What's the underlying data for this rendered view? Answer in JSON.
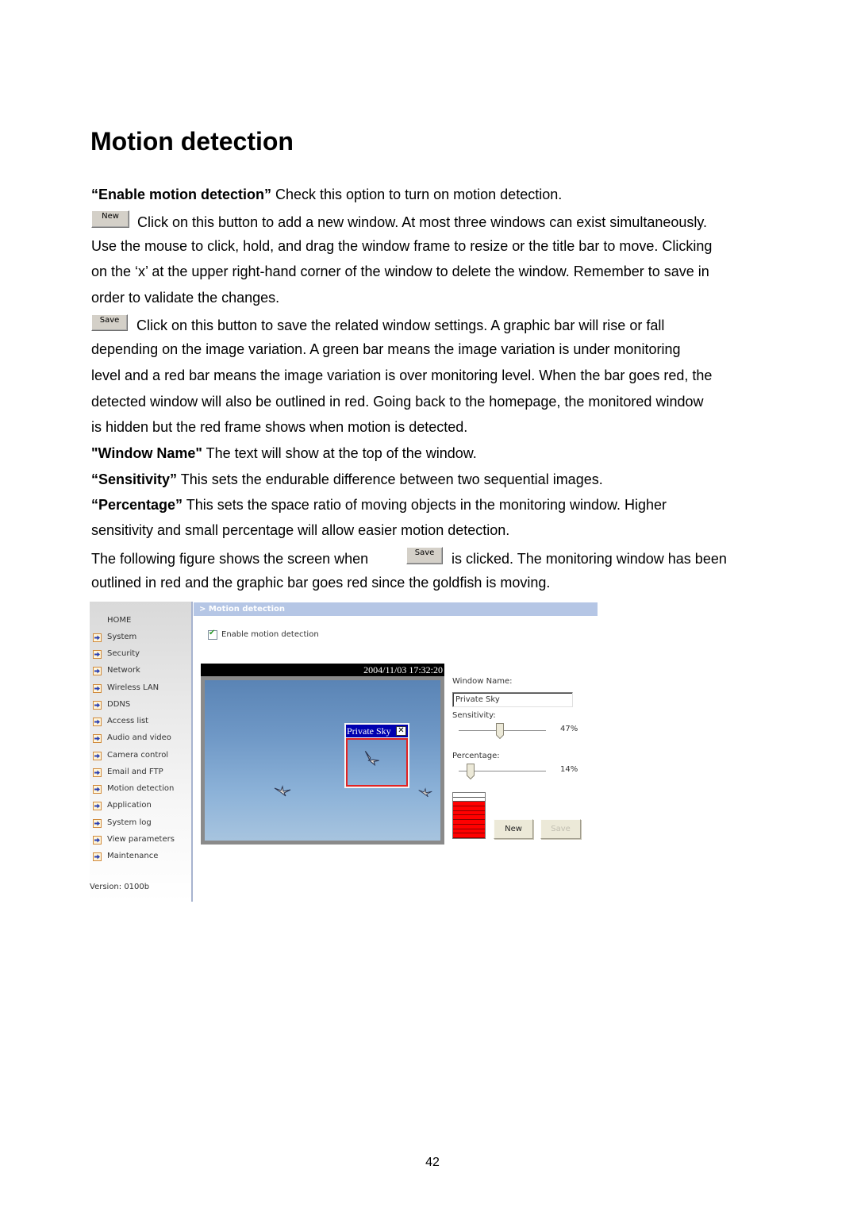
{
  "doc": {
    "title": "Motion detection",
    "p1": {
      "term": "“Enable motion detection”",
      "text": " Check this option to turn on motion detection."
    },
    "p2": {
      "button_label": "New",
      "lines": [
        "Click on this button to add a new window. At most three windows can exist simultaneously.",
        "Use the mouse to click, hold, and drag the window frame to resize or the title bar to move. Clicking",
        "on the ‘x’ at the upper right-hand corner of the window to delete the window. Remember to save in",
        "order to validate the changes."
      ]
    },
    "p3": {
      "button_label": "Save",
      "lines": [
        "Click on this button to save the related window settings. A graphic bar will rise or fall",
        "depending on the image variation. A green bar means the image variation is under monitoring",
        "level and a red bar means the image variation is over monitoring level. When the bar goes red, the",
        "detected window will also be outlined in red. Going back to the homepage, the monitored window",
        "is hidden but the red frame shows when motion is detected."
      ]
    },
    "p4": {
      "term": "\"Window Name\"",
      "text": " The text will show at the top of the window."
    },
    "p5": {
      "term": "“Sensitivity”",
      "text": " This sets the endurable difference between two sequential images."
    },
    "p6": {
      "term": "“Percentage”",
      "lines": [
        " This sets the space ratio of moving objects in the monitoring window. Higher",
        "sensitivity and small percentage will allow easier motion detection."
      ]
    },
    "p7": {
      "before": "The following figure shows the screen when",
      "button_label": "Save",
      "after": "is clicked. The monitoring window has been",
      "line2": "outlined in red and the graphic bar goes red since the goldfish is moving."
    },
    "page_number": "42"
  },
  "screenshot": {
    "sidebar": {
      "home": "HOME",
      "items": [
        "System",
        "Security",
        "Network",
        "Wireless LAN",
        "DDNS",
        "Access list",
        "Audio and video",
        "Camera control",
        "Email and FTP",
        "Motion detection",
        "Application",
        "System log",
        "View parameters",
        "Maintenance"
      ],
      "item_icon": "arrow-right-icon",
      "version": "Version: 0100b"
    },
    "header": "> Motion detection",
    "enable_checkbox": {
      "label": "Enable motion detection",
      "checked": true
    },
    "video": {
      "timestamp": "2004/11/03 17:32:20",
      "window": {
        "title": "Private Sky",
        "close_glyph": "✕",
        "outline_color": "#e22222"
      }
    },
    "form": {
      "window_name_label": "Window Name:",
      "window_name_value": "Private Sky",
      "sensitivity_label": "Sensitivity:",
      "sensitivity_value": 47,
      "sensitivity_text": "47%",
      "percentage_label": "Percentage:",
      "percentage_value": 14,
      "percentage_text": "14%",
      "level": {
        "segments": 10,
        "lit": 8,
        "lit_color": "#ff0000",
        "state": "over monitoring level"
      },
      "new_label": "New",
      "save_label": "Save",
      "save_disabled": true
    }
  },
  "colors": {
    "header_bar": "#b5c6e5",
    "window_title_bar": "#0000b0",
    "alarm_red": "#ff0000"
  }
}
